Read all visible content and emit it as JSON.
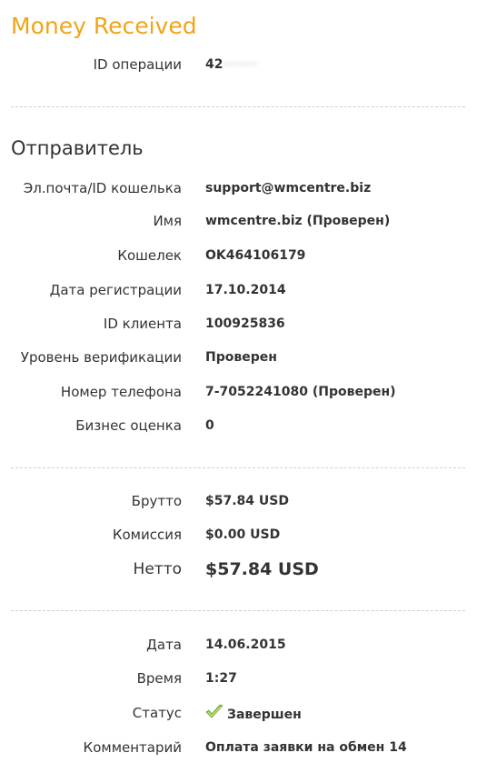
{
  "header": {
    "title": "Money Received"
  },
  "operation": {
    "id_label": "ID операции",
    "id_value_visible": "42",
    "id_value_hidden": "·······"
  },
  "sender": {
    "section_title": "Отправитель",
    "rows": [
      {
        "label": "Эл.почта/ID кошелька",
        "value": "support@wmcentre.biz"
      },
      {
        "label": "Имя",
        "value": "wmcentre.biz (Проверен)"
      },
      {
        "label": "Кошелек",
        "value": "OK464106179"
      },
      {
        "label": "Дата регистрации",
        "value": "17.10.2014"
      },
      {
        "label": "ID клиента",
        "value": "100925836"
      },
      {
        "label": "Уровень верификации",
        "value": "Проверен"
      },
      {
        "label": "Номер телефона",
        "value": "7-7052241080 (Проверен)"
      },
      {
        "label": "Бизнес оценка",
        "value": "0"
      }
    ]
  },
  "amounts": {
    "gross": {
      "label": "Брутто",
      "value": "$57.84 USD"
    },
    "fee": {
      "label": "Комиссия",
      "value": "$0.00 USD"
    },
    "net": {
      "label": "Нетто",
      "value": "$57.84 USD"
    }
  },
  "details": {
    "date": {
      "label": "Дата",
      "value": "14.06.2015"
    },
    "time": {
      "label": "Время",
      "value": "1:27"
    },
    "status": {
      "label": "Статус",
      "value": "Завершен",
      "icon": "check-icon",
      "icon_color": "#8cc63f"
    },
    "comment": {
      "label": "Комментарий",
      "value": "Оплата заявки на обмен 14"
    }
  }
}
